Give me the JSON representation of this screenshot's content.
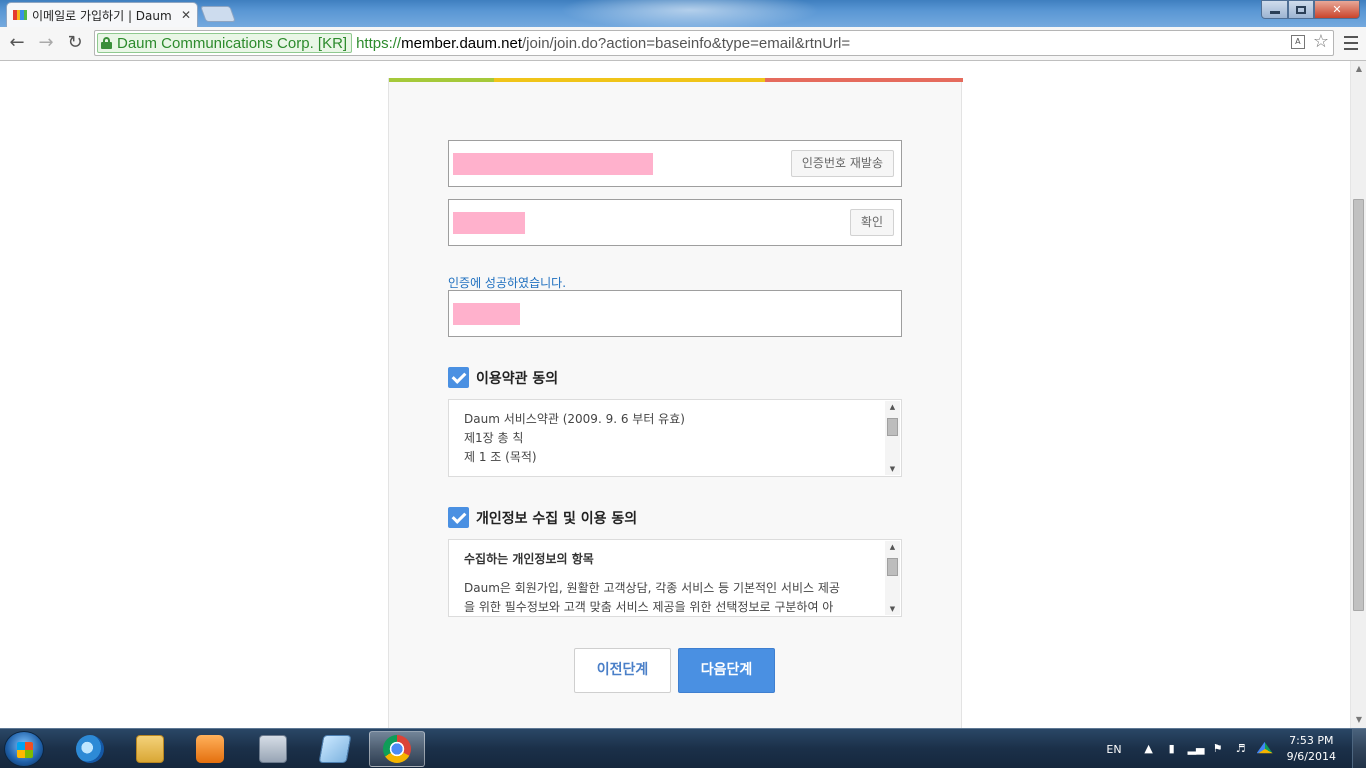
{
  "browser": {
    "tab_title": "이메일로 가입하기 | Daum",
    "tab_close": "✕",
    "ev_label": "Daum Communications Corp. [KR]",
    "url_scheme": "https://",
    "url_host": "member.daum.net",
    "url_path": "/join/join.do?action=baseinfo&type=email&rtnUrl="
  },
  "form": {
    "progress_colors": [
      "#a5c93a",
      "#f0c419",
      "#e56b5d"
    ],
    "resend_button": "인증번호 재발송",
    "confirm_button": "확인",
    "success_message": "인증에 성공하였습니다.",
    "terms_agree_label": "이용약관 동의",
    "terms_lines": [
      "Daum 서비스약관 (2009. 9. 6 부터 유효)",
      "제1장 총 칙",
      "제 1 조 (목적)"
    ],
    "privacy_agree_label": "개인정보 수집 및 이용 동의",
    "privacy_heading": "수집하는 개인정보의 항목",
    "privacy_lines": [
      "Daum은 회원가입, 원활한 고객상담, 각종 서비스 등 기본적인 서비스 제공",
      "을 위한 필수정보와 고객 맞춤 서비스 제공을 위한 선택정보로 구분하여 아"
    ],
    "prev_button": "이전단계",
    "next_button": "다음단계"
  },
  "taskbar": {
    "language": "EN",
    "time": "7:53 PM",
    "date": "9/6/2014"
  }
}
